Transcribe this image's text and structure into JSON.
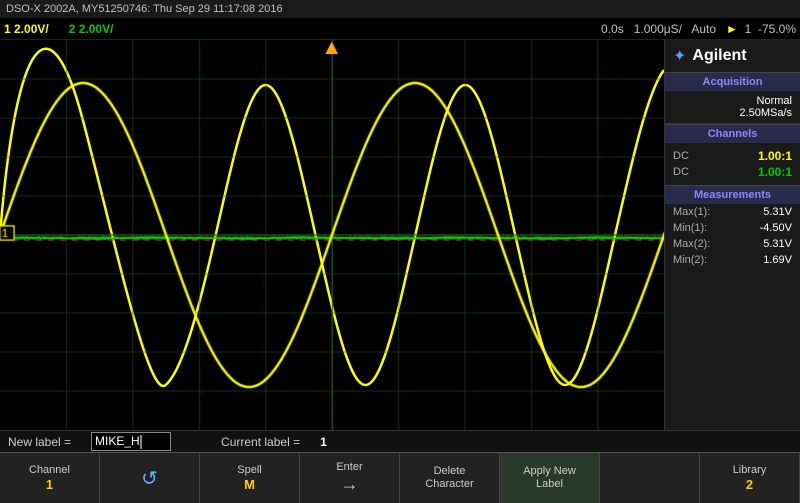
{
  "status_bar": {
    "text": "DSO-X 2002A, MY51250746: Thu Sep 29 11:17:08 2016"
  },
  "channel_bar": {
    "ch1": "1  2.00V/",
    "ch2": "2  2.00V/",
    "time": "0.0s",
    "timebase": "1.000μS/",
    "trigger": "Auto",
    "icon": "f",
    "ch_num": "1",
    "voltage": "-75.0%"
  },
  "right_panel": {
    "logo": "Agilent",
    "acquisition_label": "Acquisition",
    "acq_mode": "Normal",
    "acq_rate": "2.50MSa/s",
    "channels_label": "Channels",
    "ch1_coupling": "DC",
    "ch1_value": "1.00:1",
    "ch2_coupling": "DC",
    "ch2_value": "1.00:1",
    "measurements_label": "Measurements",
    "max1_label": "Max(1):",
    "max1_value": "5.31V",
    "min1_label": "Min(1):",
    "min1_value": "-4.50V",
    "max2_label": "Max(2):",
    "max2_value": "5.31V",
    "min2_label": "Min(2):",
    "min2_value": "1.69V"
  },
  "label_bar": {
    "new_label_prefix": "New label =",
    "new_label_value": "MIKE_H",
    "current_label_prefix": "Current label =",
    "current_label_value": "1"
  },
  "buttons": [
    {
      "id": "channel",
      "top": "Channel",
      "bottom": "1",
      "type": "number"
    },
    {
      "id": "rotate",
      "top": "",
      "bottom": "↺",
      "type": "icon"
    },
    {
      "id": "spell",
      "top": "Spell",
      "bottom": "M",
      "type": "text"
    },
    {
      "id": "enter",
      "top": "Enter",
      "bottom": "→",
      "type": "arrow"
    },
    {
      "id": "delete",
      "top": "Delete",
      "bottom": "Character",
      "type": "text-sm"
    },
    {
      "id": "apply",
      "top": "Apply New",
      "bottom": "Label",
      "type": "text-sm",
      "active": true
    },
    {
      "id": "blank1",
      "top": "",
      "bottom": "",
      "type": "empty"
    },
    {
      "id": "library",
      "top": "Library",
      "bottom": "2",
      "type": "number"
    }
  ],
  "colors": {
    "ch1_color": "#ffff00",
    "ch2_color": "#00dd00",
    "trig_color": "#ff4444",
    "grid_color": "#1a3a1a",
    "bg_color": "#000000",
    "accent": "#5599ff"
  }
}
